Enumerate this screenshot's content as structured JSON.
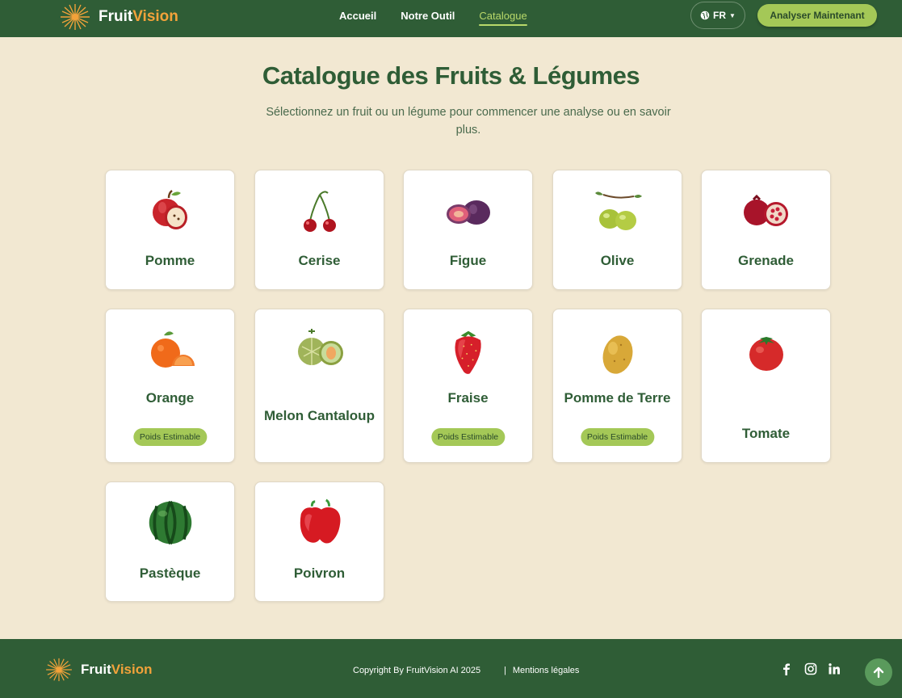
{
  "brand": {
    "part1": "Fruit",
    "part2": "Vision"
  },
  "nav": {
    "items": [
      {
        "label": "Accueil"
      },
      {
        "label": "Notre Outil"
      },
      {
        "label": "Catalogue"
      }
    ],
    "active_label": "Catalogue"
  },
  "language": {
    "label": "FR",
    "icon": "globe-icon"
  },
  "cta_label": "Analyser Maintenant",
  "main": {
    "title": "Catalogue des Fruits & Légumes",
    "subtitle": "Sélectionnez un fruit ou un légume pour commencer une analyse ou en savoir plus."
  },
  "catalog": [
    {
      "name": "Pomme",
      "icon": "apple-icon"
    },
    {
      "name": "Cerise",
      "icon": "cherry-icon"
    },
    {
      "name": "Figue",
      "icon": "fig-icon"
    },
    {
      "name": "Olive",
      "icon": "olive-icon"
    },
    {
      "name": "Grenade",
      "icon": "pomegranate-icon"
    },
    {
      "name": "Orange",
      "icon": "orange-icon",
      "badge": "Poids Estimable"
    },
    {
      "name": "Melon Cantaloup",
      "icon": "melon-icon"
    },
    {
      "name": "Fraise",
      "icon": "strawberry-icon",
      "badge": "Poids Estimable"
    },
    {
      "name": "Pomme de Terre",
      "icon": "potato-icon",
      "badge": "Poids Estimable"
    },
    {
      "name": "Tomate",
      "icon": "tomato-icon"
    },
    {
      "name": "Pastèque",
      "icon": "watermelon-icon"
    },
    {
      "name": "Poivron",
      "icon": "pepper-icon"
    }
  ],
  "footer": {
    "copyright": "Copyright By FruitVision AI 2025",
    "legal_separator": "|",
    "legal_label": "Mentions légales",
    "social": [
      "facebook-icon",
      "instagram-icon",
      "linkedin-icon"
    ],
    "back_to_top_icon": "arrow-up-icon"
  },
  "colors": {
    "primary_green": "#2f5d36",
    "accent_lime": "#a4c857",
    "background": "#f2e8d2",
    "brand_orange": "#f2a23a"
  }
}
